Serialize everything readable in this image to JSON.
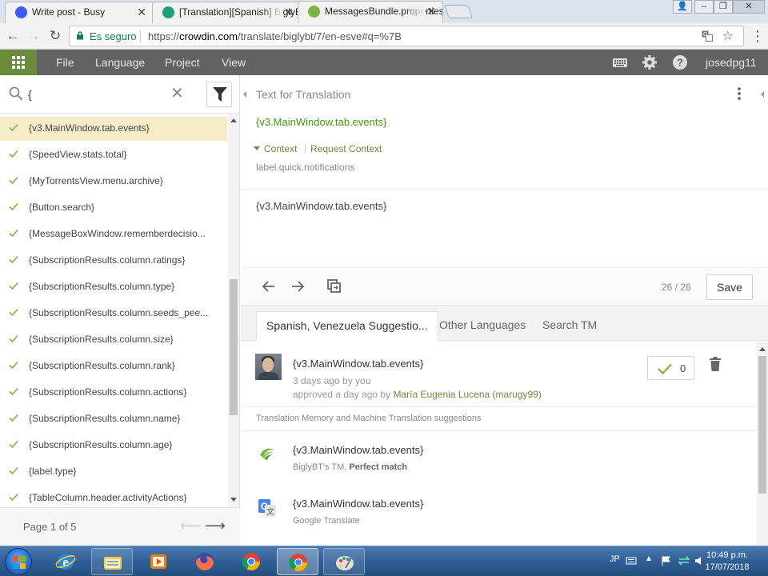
{
  "browser": {
    "tabs": [
      {
        "title": "Write post - Busy",
        "favicon_color": "#3d5afe"
      },
      {
        "title": "[Translation][Spanish] BiglyBT",
        "favicon_color": "#1aa37a"
      },
      {
        "title": "MessagesBundle.properties",
        "favicon_color": "#7cb342"
      }
    ],
    "secure_label": "Es seguro",
    "url_scheme": "https://",
    "url_host": "crowdin.com",
    "url_path": "/translate/biglybt/7/en-esve#q=%7B"
  },
  "app": {
    "menu": [
      "File",
      "Language",
      "Project",
      "View"
    ],
    "username": "josedpg11",
    "accent": "#6a8b3c"
  },
  "left_panel": {
    "search_value": "{",
    "strings": [
      {
        "text": "{v3.MainWindow.tab.events}",
        "selected": true
      },
      {
        "text": "{SpeedView.stats.total}"
      },
      {
        "text": "{MyTorrentsView.menu.archive}"
      },
      {
        "text": "{Button.search}"
      },
      {
        "text": "{MessageBoxWindow.rememberdecisio..."
      },
      {
        "text": "{SubscriptionResults.column.ratings}"
      },
      {
        "text": "{SubscriptionResults.column.type}"
      },
      {
        "text": "{SubscriptionResults.column.seeds_pee..."
      },
      {
        "text": "{SubscriptionResults.column.size}"
      },
      {
        "text": "{SubscriptionResults.column.rank}"
      },
      {
        "text": "{SubscriptionResults.column.actions}"
      },
      {
        "text": "{SubscriptionResults.column.name}"
      },
      {
        "text": "{SubscriptionResults.column.age}"
      },
      {
        "text": "{label.type}"
      },
      {
        "text": "{TableColumn.header.activityActions}"
      }
    ],
    "page_label": "Page 1 of 5"
  },
  "editor": {
    "header": "Text for Translation",
    "source_text": "{v3.MainWindow.tab.events}",
    "context_label": "Context",
    "request_context_label": "Request Context",
    "context_value": "label.quick.notifications",
    "translation_value": "{v3.MainWindow.tab.events}",
    "counter": "26 / 26",
    "save_label": "Save",
    "tabs": [
      "Spanish, Venezuela Suggestio...",
      "Other Languages",
      "Search TM"
    ],
    "suggestion": {
      "text": "{v3.MainWindow.tab.events}",
      "meta1": "3 days ago by you",
      "meta2_prefix": "approved a day ago by ",
      "approver": "María Eugenia Lucena (marugy99)",
      "votes": "0"
    },
    "tm_header": "Translation Memory and Machine Translation suggestions",
    "tm_items": [
      {
        "text": "{v3.MainWindow.tab.events}",
        "source": "BiglyBT's TM, ",
        "match": "Perfect match",
        "icon": "biglybt-icon"
      },
      {
        "text": "{v3.MainWindow.tab.events}",
        "source": "Google Translate",
        "match": "",
        "icon": "google-translate-icon"
      }
    ]
  },
  "taskbar": {
    "lang": "JP",
    "time": "10:49 p.m.",
    "date": "17/07/2018"
  }
}
